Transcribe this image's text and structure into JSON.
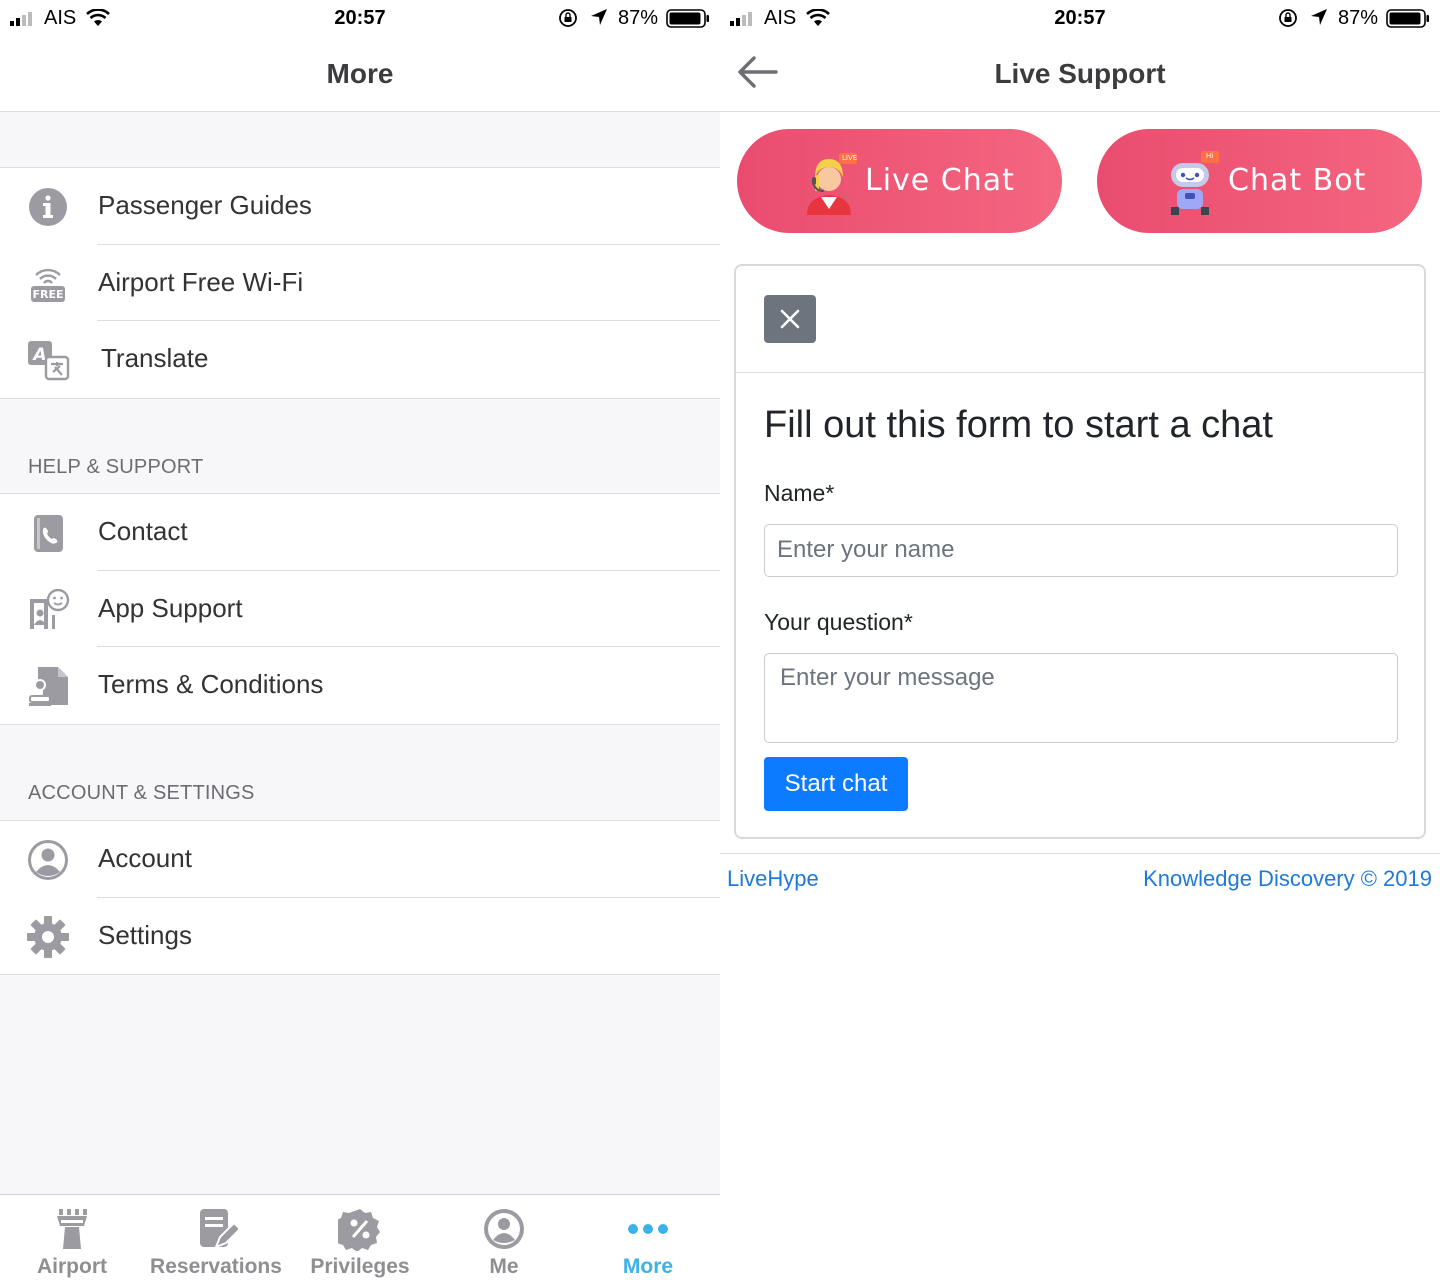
{
  "status_bar": {
    "carrier": "AIS",
    "time": "20:57",
    "battery_pct": "87%"
  },
  "left_screen": {
    "title": "More",
    "groups": [
      {
        "header": "",
        "items": [
          {
            "label": "Passenger Guides",
            "icon": "info-icon"
          },
          {
            "label": "Airport Free Wi-Fi",
            "icon": "free-wifi-icon"
          },
          {
            "label": "Translate",
            "icon": "translate-icon"
          }
        ]
      },
      {
        "header": "HELP & SUPPORT",
        "items": [
          {
            "label": "Contact",
            "icon": "phone-book-icon"
          },
          {
            "label": "App Support",
            "icon": "app-support-icon"
          },
          {
            "label": "Terms & Conditions",
            "icon": "document-stamp-icon"
          }
        ]
      },
      {
        "header": "ACCOUNT & SETTINGS",
        "items": [
          {
            "label": "Account",
            "icon": "account-icon"
          },
          {
            "label": "Settings",
            "icon": "gear-icon"
          }
        ]
      }
    ],
    "tabs": [
      {
        "label": "Airport",
        "icon": "airport-tower-icon",
        "active": false
      },
      {
        "label": "Reservations",
        "icon": "reservation-icon",
        "active": false
      },
      {
        "label": "Privileges",
        "icon": "discount-badge-icon",
        "active": false
      },
      {
        "label": "Me",
        "icon": "user-icon",
        "active": false
      },
      {
        "label": "More",
        "icon": "more-dots-icon",
        "active": true
      }
    ],
    "colors": {
      "active_tab": "#3bb2e8",
      "inactive_tab": "#8e8e93"
    }
  },
  "right_screen": {
    "title": "Live Support",
    "live_chat_label": "Live Chat",
    "chat_bot_label": "Chat Bot",
    "live_badge": "LIVE",
    "bot_badge": "Hi",
    "form": {
      "heading": "Fill out this form to start a chat",
      "name_label": "Name*",
      "name_placeholder": "Enter your name",
      "question_label": "Your question*",
      "question_placeholder": "Enter your message",
      "submit_label": "Start chat"
    },
    "footer": {
      "left": "LiveHype",
      "right": "Knowledge Discovery © 2019"
    },
    "colors": {
      "pill_start": "#ea4c6f",
      "pill_end": "#f46680",
      "primary_button": "#0d7bff",
      "link": "#1e7ad8"
    }
  }
}
